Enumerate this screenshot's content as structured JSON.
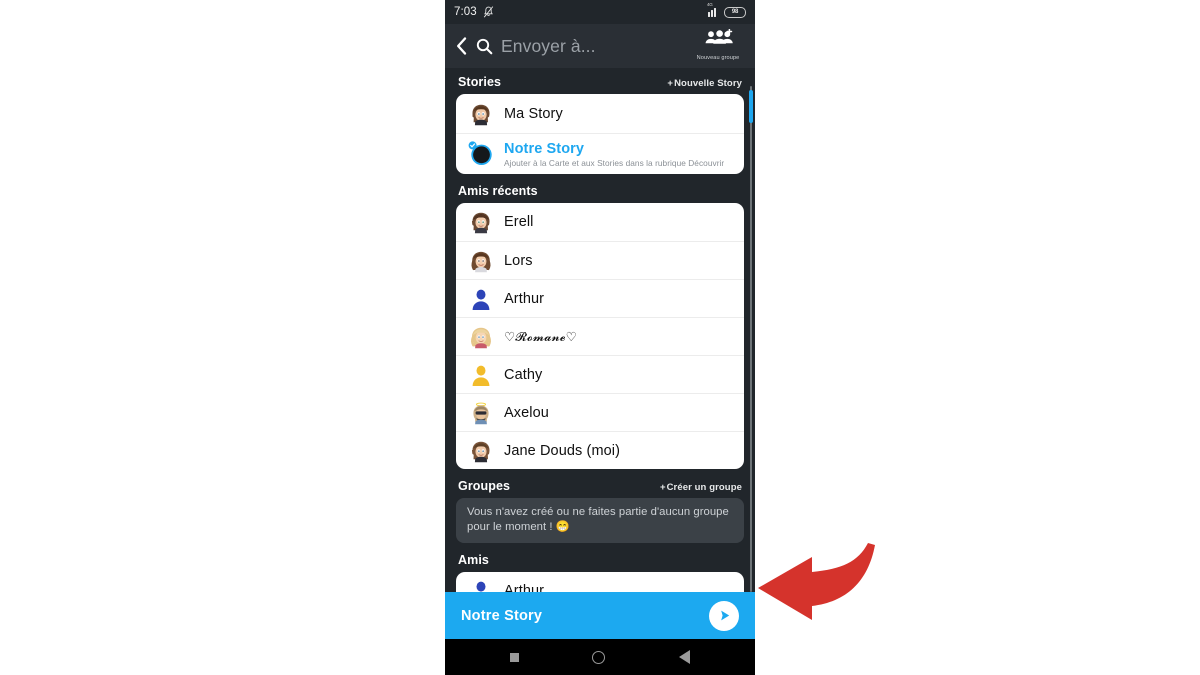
{
  "status_bar": {
    "time": "7:03",
    "bell_icon": "bell-muted-icon",
    "network": "4G",
    "battery": "98"
  },
  "header": {
    "back_icon": "back-chevron-icon",
    "search_icon": "search-icon",
    "search_placeholder": "Envoyer à...",
    "search_value": "",
    "new_group_icon": "group-add-icon",
    "new_group_label": "Nouveau groupe"
  },
  "sections": {
    "stories": {
      "title": "Stories",
      "action_plus": "+",
      "action_label": "Nouvelle Story",
      "items": [
        {
          "name": "Ma Story",
          "subtitle": "",
          "avatar": "bitmoji-woman-brown-hair"
        },
        {
          "name": "Notre Story",
          "subtitle": "Ajouter à la Carte et aux Stories dans la rubrique Découvrir",
          "avatar": "our-story-dark-circle-check"
        }
      ]
    },
    "recent_friends": {
      "title": "Amis récents",
      "items": [
        {
          "name": "Erell",
          "avatar": "bitmoji-woman-brown-hair"
        },
        {
          "name": "Lors",
          "avatar": "bitmoji-woman-curly-hair"
        },
        {
          "name": "Arthur",
          "avatar": "default-avatar-blue"
        },
        {
          "name": "♡𝓡𝓸𝓶𝓪𝓷𝓮♡",
          "avatar": "bitmoji-woman-blonde"
        },
        {
          "name": "Cathy",
          "avatar": "default-avatar-yellow"
        },
        {
          "name": "Axelou",
          "avatar": "bitmoji-man-sunglasses"
        },
        {
          "name": "Jane Douds (moi)",
          "avatar": "bitmoji-woman-brown-hair"
        }
      ]
    },
    "groups": {
      "title": "Groupes",
      "action_plus": "+",
      "action_label": "Créer un groupe",
      "empty_message": "Vous n'avez créé ou ne faites partie d'aucun groupe pour le moment ! 😁"
    },
    "friends": {
      "title": "Amis",
      "items": [
        {
          "name": "Arthur",
          "avatar": "default-avatar-blue"
        }
      ]
    }
  },
  "send_bar": {
    "label": "Notre Story",
    "send_icon": "send-arrow-icon"
  },
  "nav_bar": {
    "recents_icon": "square-icon",
    "home_icon": "circle-icon",
    "back_icon": "triangle-back-icon"
  },
  "annotation": {
    "arrow_icon": "curved-arrow-left-icon",
    "color": "#d5332c"
  },
  "colors": {
    "accent": "#1ca9f0",
    "phone_bg": "#21262b",
    "header_bg": "#2a2f35",
    "card_bg": "#ffffff",
    "empty_bg": "#3b4147"
  }
}
